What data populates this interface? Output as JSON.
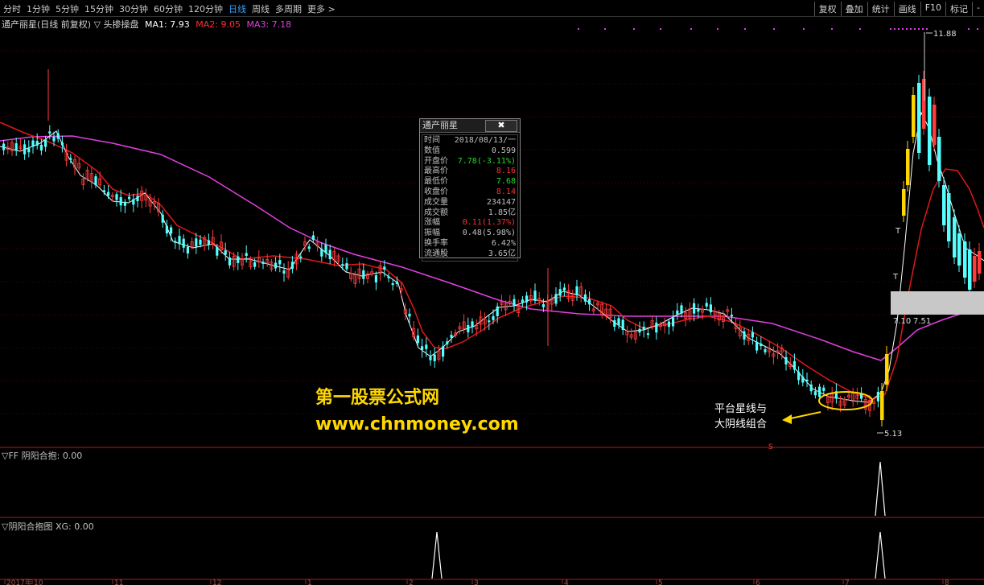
{
  "toolbar": {
    "periods": [
      "分时",
      "1分钟",
      "5分钟",
      "15分钟",
      "30分钟",
      "60分钟",
      "120分钟",
      "日线",
      "周线",
      "多周期",
      "更多 >"
    ],
    "active_period": "日线",
    "buttons": [
      "复权",
      "叠加",
      "统计",
      "画线",
      "F10",
      "标记",
      "-"
    ]
  },
  "main_header": {
    "title": "通产丽星(日线 前复权) ▽ 头掺操盘",
    "ma1": "MA1: 7.93",
    "ma2": "MA2: 9.05",
    "ma3": "MA3: 7.18"
  },
  "popup": {
    "title": "通产丽星",
    "close": "✖",
    "rows": [
      {
        "label": "时间",
        "value": "2018/08/13/一",
        "color": "#c0c0c0"
      },
      {
        "label": "数值",
        "value": "0.599",
        "color": "#c0c0c0"
      },
      {
        "label": "开盘价",
        "value": "7.78(-3.11%)",
        "color": "#22dd22"
      },
      {
        "label": "最高价",
        "value": "8.16",
        "color": "#ff3030"
      },
      {
        "label": "最低价",
        "value": "7.68",
        "color": "#22dd22"
      },
      {
        "label": "收盘价",
        "value": "8.14",
        "color": "#ff3030"
      },
      {
        "label": "成交量",
        "value": "234147",
        "color": "#c0c0c0"
      },
      {
        "label": "成交额",
        "value": "1.85亿",
        "color": "#c0c0c0"
      },
      {
        "label": "涨幅",
        "value": "0.11(1.37%)",
        "color": "#ff3030"
      },
      {
        "label": "振幅",
        "value": "0.48(5.98%)",
        "color": "#c0c0c0"
      },
      {
        "label": "换手率",
        "value": "6.42%",
        "color": "#c0c0c0"
      },
      {
        "label": "流通股",
        "value": "3.65亿",
        "color": "#c0c0c0"
      }
    ]
  },
  "price_labels": {
    "high": "11.88",
    "low": "5.13",
    "mid_left": "7.10",
    "mid_right": "7.51"
  },
  "watermark": {
    "line1": "第一股票公式网",
    "line2": "www.chnmoney.com"
  },
  "annotation": {
    "line1": "平台星线与",
    "line2": "大阴线组合"
  },
  "marker_s": "S",
  "indicator1": {
    "title": "▽FF 阴阳合抱: 0.00"
  },
  "indicator2": {
    "title": "▽阴阳合抱图 XG: 0.00"
  },
  "date_axis": [
    "2017年",
    "10",
    "11",
    "12",
    "1",
    "2",
    "3",
    "4",
    "5",
    "6",
    "7",
    "8"
  ],
  "colors": {
    "up": "#ff3c3c",
    "down": "#54ffff",
    "ma1": "#ffffff",
    "ma2": "#e01818",
    "ma3": "#e040e0",
    "highlight": "#ffd700",
    "border": "#a02020"
  }
}
